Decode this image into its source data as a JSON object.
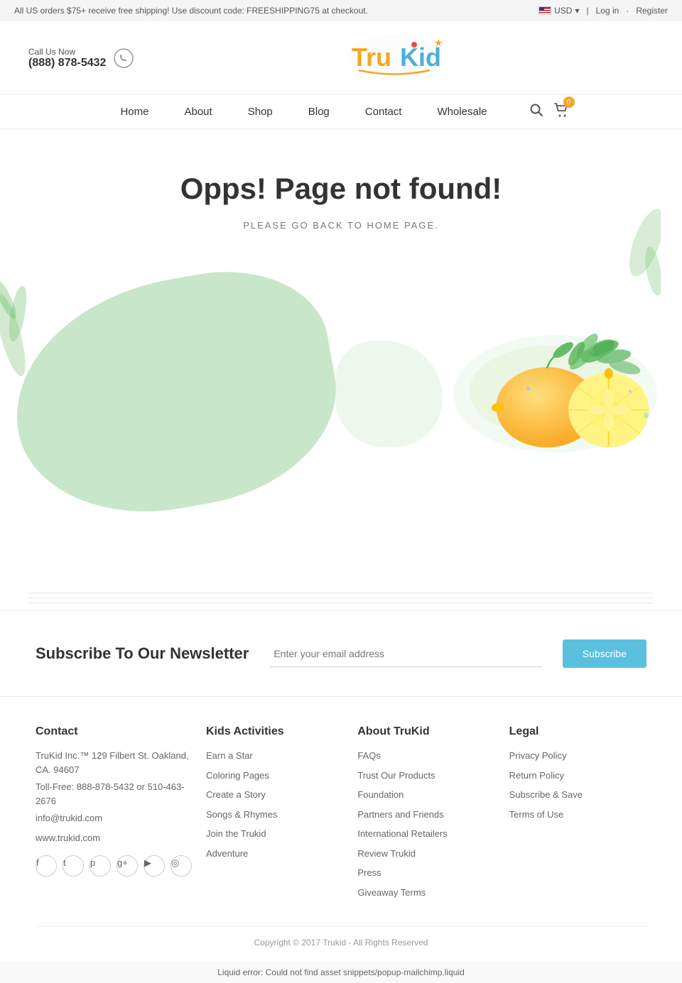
{
  "top_bar": {
    "promo_text": "All US orders $75+ receive free shipping! Use discount code: FREESHIPPING75 at checkout.",
    "currency": "USD",
    "login_label": "Log in",
    "register_label": "Register"
  },
  "header": {
    "phone_label": "Call Us Now",
    "phone_number": "(888) 878-5432"
  },
  "nav": {
    "items": [
      {
        "label": "Home",
        "href": "#"
      },
      {
        "label": "About",
        "href": "#"
      },
      {
        "label": "Shop",
        "href": "#"
      },
      {
        "label": "Blog",
        "href": "#"
      },
      {
        "label": "Contact",
        "href": "#"
      },
      {
        "label": "Wholesale",
        "href": "#"
      }
    ],
    "cart_count": "0"
  },
  "main": {
    "error_title": "Opps! Page not found!",
    "error_subtitle": "PLEASE GO BACK TO HOME PAGE."
  },
  "newsletter": {
    "title": "Subscribe To Our Newsletter",
    "input_placeholder": "Enter your email address",
    "button_label": "Subscribe"
  },
  "footer": {
    "contact": {
      "title": "Contact",
      "address": "TruKid Inc.™ 129 Filbert St. Oakland, CA. 94607",
      "phone": "Toll-Free: 888-878-5432 or 510-463-2676",
      "email": "info@trukid.com",
      "website": "www.trukid.com"
    },
    "kids_activities": {
      "title": "Kids Activities",
      "links": [
        {
          "label": "Earn a Star",
          "href": "#"
        },
        {
          "label": "Coloring Pages",
          "href": "#"
        },
        {
          "label": "Create a Story",
          "href": "#"
        },
        {
          "label": "Songs & Rhymes",
          "href": "#"
        },
        {
          "label": "Join the Trukid",
          "href": "#"
        },
        {
          "label": "Adventure",
          "href": "#"
        }
      ]
    },
    "about_trukid": {
      "title": "About TruKid",
      "links": [
        {
          "label": "FAQs",
          "href": "#"
        },
        {
          "label": "Trust Our Products",
          "href": "#"
        },
        {
          "label": "Foundation",
          "href": "#"
        },
        {
          "label": "Partners and Friends",
          "href": "#"
        },
        {
          "label": "International Retailers",
          "href": "#"
        },
        {
          "label": "Review Trukid",
          "href": "#"
        },
        {
          "label": "Press",
          "href": "#"
        },
        {
          "label": "Giveaway Terms",
          "href": "#"
        }
      ]
    },
    "legal": {
      "title": "Legal",
      "links": [
        {
          "label": "Privacy Policy",
          "href": "#"
        },
        {
          "label": "Return Policy",
          "href": "#"
        },
        {
          "label": "Subscribe & Save",
          "href": "#"
        },
        {
          "label": "Terms of Use",
          "href": "#"
        }
      ]
    },
    "social": [
      {
        "name": "facebook",
        "icon": "f"
      },
      {
        "name": "twitter",
        "icon": "t"
      },
      {
        "name": "pinterest",
        "icon": "p"
      },
      {
        "name": "google-plus",
        "icon": "g+"
      },
      {
        "name": "youtube",
        "icon": "▶"
      },
      {
        "name": "instagram",
        "icon": "📷"
      }
    ],
    "copyright": "Copyright © 2017 Trukid - All Rights Reserved"
  },
  "liquid_error": "Liquid error: Could not find asset snippets/popup-mailchimp.liquid"
}
